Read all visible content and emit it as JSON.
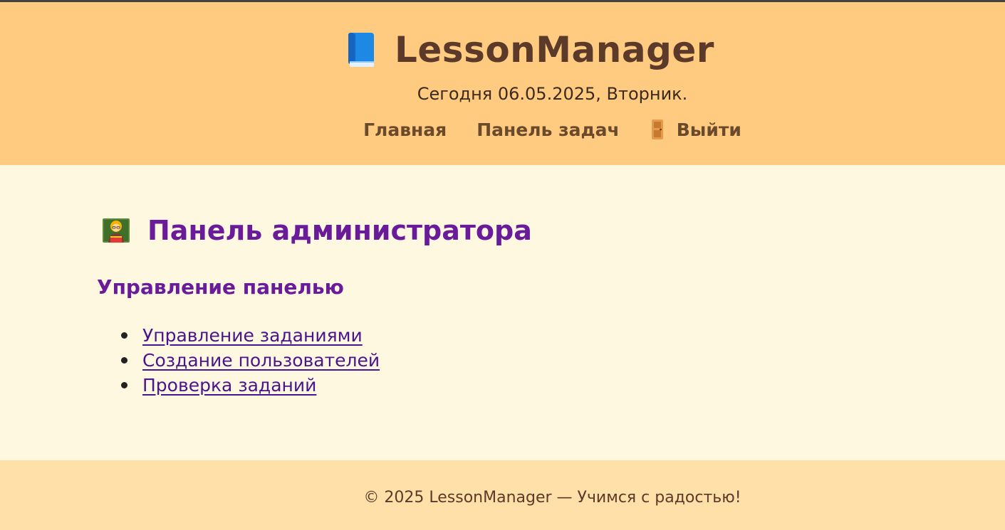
{
  "header": {
    "app_title": "LessonManager",
    "today_text": "Сегодня 06.05.2025, Вторник.",
    "logo_icon": "blue-book-icon",
    "nav": {
      "home_label": "Главная",
      "tasks_label": "Панель задач",
      "logout_label": "Выйти",
      "logout_icon": "door-icon"
    }
  },
  "main": {
    "title": "Панель администратора",
    "title_icon": "teacher-icon",
    "section_title": "Управление панелью",
    "links": [
      {
        "label": "Управление заданиями"
      },
      {
        "label": "Создание пользователей"
      },
      {
        "label": "Проверка заданий"
      }
    ]
  },
  "footer": {
    "text": "© 2025 LessonManager — Учимся с радостью!"
  },
  "colors": {
    "header_bg": "#ffcb80",
    "page_bg": "#fff8e1",
    "footer_bg": "#ffe0a8",
    "heading_purple": "#6a1b9a",
    "brand_brown": "#5b3a29"
  }
}
